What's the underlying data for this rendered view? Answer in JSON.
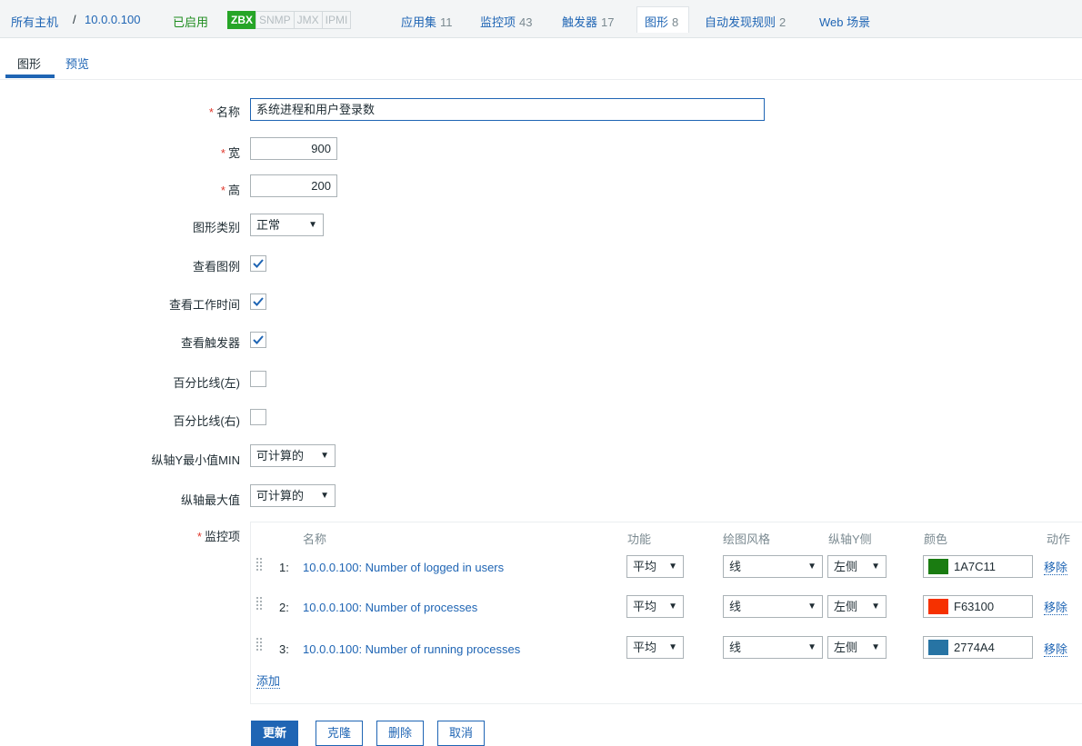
{
  "topnav": {
    "all_hosts": "所有主机",
    "separator": "/",
    "host": "10.0.0.100",
    "status": "已启用",
    "badges": [
      "ZBX",
      "SNMP",
      "JMX",
      "IPMI"
    ],
    "tabs": [
      {
        "label": "应用集",
        "count": "11"
      },
      {
        "label": "监控项",
        "count": "43"
      },
      {
        "label": "触发器",
        "count": "17"
      },
      {
        "label": "图形",
        "count": "8"
      },
      {
        "label": "自动发现规则",
        "count": "2"
      },
      {
        "label": "Web 场景",
        "count": ""
      }
    ]
  },
  "subtabs": {
    "graph": "图形",
    "preview": "预览"
  },
  "form": {
    "name": {
      "label": "名称",
      "value": "系统进程和用户登录数"
    },
    "width": {
      "label": "宽",
      "value": "900"
    },
    "height": {
      "label": "高",
      "value": "200"
    },
    "graph_type": {
      "label": "图形类别",
      "value": "正常"
    },
    "show_legend": {
      "label": "查看图例",
      "checked": true
    },
    "show_working_time": {
      "label": "查看工作时间",
      "checked": true
    },
    "show_triggers": {
      "label": "查看触发器",
      "checked": true
    },
    "percentile_left": {
      "label": "百分比线(左)",
      "checked": false
    },
    "percentile_right": {
      "label": "百分比线(右)",
      "checked": false
    },
    "y_min": {
      "label": "纵轴Y最小值MIN",
      "value": "可计算的"
    },
    "y_max": {
      "label": "纵轴最大值",
      "value": "可计算的"
    },
    "items_label": "监控项"
  },
  "items_table": {
    "headers": {
      "name": "名称",
      "function": "功能",
      "draw_style": "绘图风格",
      "y_axis_side": "纵轴Y侧",
      "color": "颜色",
      "action": "动作"
    },
    "rows": [
      {
        "num": "1:",
        "name": "10.0.0.100: Number of logged in users",
        "function": "平均",
        "draw_style": "线",
        "y_axis_side": "左侧",
        "color": "1A7C11",
        "action": "移除"
      },
      {
        "num": "2:",
        "name": "10.0.0.100: Number of processes",
        "function": "平均",
        "draw_style": "线",
        "y_axis_side": "左侧",
        "color": "F63100",
        "action": "移除"
      },
      {
        "num": "3:",
        "name": "10.0.0.100: Number of running processes",
        "function": "平均",
        "draw_style": "线",
        "y_axis_side": "左侧",
        "color": "2774A4",
        "action": "移除"
      }
    ],
    "add_label": "添加"
  },
  "buttons": {
    "update": "更新",
    "clone": "克隆",
    "delete": "删除",
    "cancel": "取消"
  },
  "colors": {
    "link": "#1f65b4",
    "enabled": "#1d8c1d",
    "zbx_badge": "#26a527",
    "required": "#e0382c",
    "checkmark": "#1f65b4"
  },
  "icons": {
    "checkbox": "check-icon",
    "dropdown": "triangle-down-icon",
    "drag": "drag-handle-icon"
  }
}
